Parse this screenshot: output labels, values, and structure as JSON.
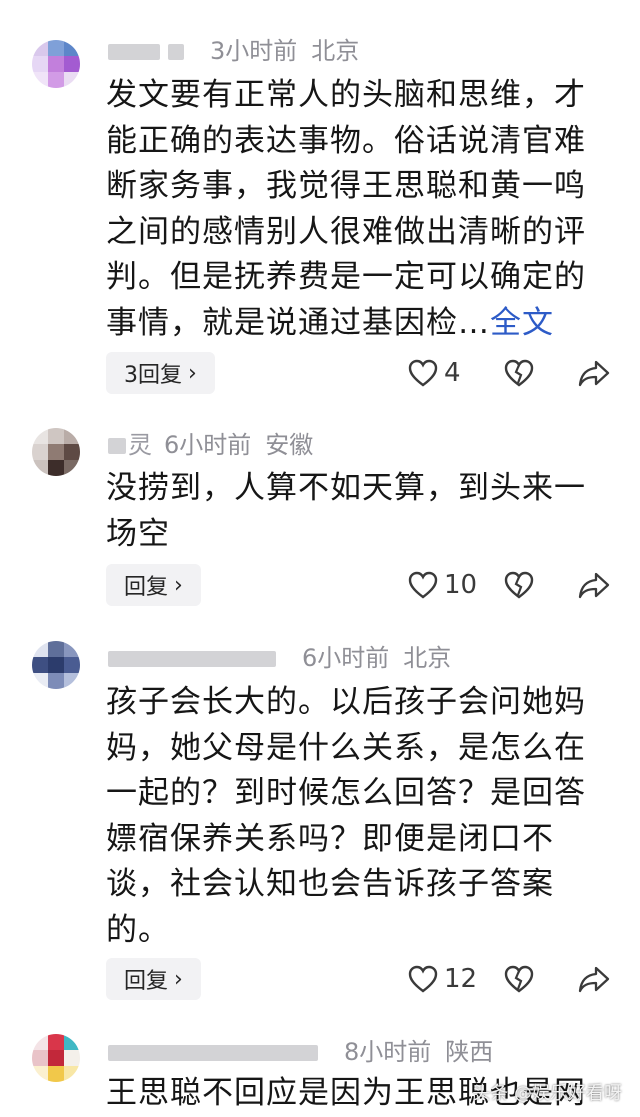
{
  "comments": [
    {
      "nickname": "",
      "time": "3小时前",
      "location": "北京",
      "text": "发文要有正常人的头脑和思维，才能正确的表达事物。俗话说清官难断家务事，我觉得王思聪和黄一鸣之间的感情别人很难做出清晰的评判。但是抚养费是一定可以确定的事情，就是说通过基因检…",
      "more": "全文",
      "reply": "3回复",
      "likes": "4"
    },
    {
      "nickname": "灵",
      "time": "6小时前",
      "location": "安徽",
      "text": "没捞到，人算不如天算，到头来一场空",
      "more": "",
      "reply": "回复",
      "likes": "10"
    },
    {
      "nickname": "",
      "time": "6小时前",
      "location": "北京",
      "text": "孩子会长大的。以后孩子会问她妈妈，她父母是什么关系，是怎么在一起的？到时候怎么回答？是回答嫖宿保养关系吗？即便是闭口不谈，社会认知也会告诉孩子答案的。",
      "more": "",
      "reply": "回复",
      "likes": "12"
    },
    {
      "nickname": "",
      "time": "8小时前",
      "location": "陕西",
      "text": "王思聪不回应是因为王思聪也是网",
      "more": "",
      "reply": "",
      "likes": ""
    }
  ],
  "watermark": "头条 @娱乐好看呀",
  "icons": {
    "like": "heart-outline-icon",
    "dislike": "broken-heart-icon",
    "share": "share-arrow-icon",
    "chevron": "chevron-right-icon"
  },
  "colors": {
    "link": "#2d5bc7",
    "meta": "#8f8f96",
    "reply_bg": "#f2f2f4"
  }
}
